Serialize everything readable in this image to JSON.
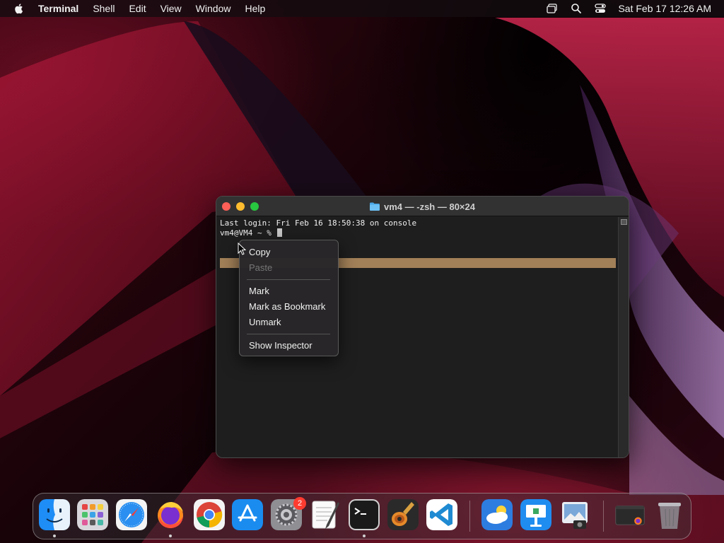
{
  "menubar": {
    "app_name": "Terminal",
    "items": [
      "Shell",
      "Edit",
      "View",
      "Window",
      "Help"
    ],
    "clock": "Sat Feb 17  12:26 AM",
    "status_icons": [
      "display-icon",
      "search-icon",
      "control-center-icon"
    ]
  },
  "window": {
    "title": "vm4 — -zsh — 80×24",
    "terminal_lines": [
      "Last login: Fri Feb 16 18:50:38 on console",
      "vm4@VM4 ~ % "
    ]
  },
  "context_menu": {
    "items": [
      {
        "label": "Copy",
        "enabled": true
      },
      {
        "label": "Paste",
        "enabled": false
      },
      {
        "label": "Mark",
        "enabled": true
      },
      {
        "label": "Mark as Bookmark",
        "enabled": true
      },
      {
        "label": "Unmark",
        "enabled": true
      },
      {
        "label": "Show Inspector",
        "enabled": true
      }
    ]
  },
  "dock": {
    "apps": [
      {
        "icon": "finder-icon",
        "running": true
      },
      {
        "icon": "launchpad-icon",
        "running": false
      },
      {
        "icon": "safari-icon",
        "running": false
      },
      {
        "icon": "firefox-icon",
        "running": true
      },
      {
        "icon": "chrome-icon",
        "running": false
      },
      {
        "icon": "app-store-icon",
        "running": false
      },
      {
        "icon": "system-settings-icon",
        "running": false,
        "badge": "2"
      },
      {
        "icon": "textedit-icon",
        "running": false
      },
      {
        "icon": "terminal-icon",
        "running": true
      },
      {
        "icon": "garageband-icon",
        "running": false
      },
      {
        "icon": "vscode-icon",
        "running": false
      },
      {
        "icon": "weather-icon",
        "running": false
      },
      {
        "icon": "keynote-icon",
        "running": false
      },
      {
        "icon": "preview-icon",
        "running": false
      },
      {
        "icon": "minimized-window-icon",
        "running": false
      },
      {
        "icon": "trash-icon",
        "running": false
      }
    ]
  },
  "colors": {
    "terminal_bg": "#1e1e1e",
    "selection": "#a28058",
    "close": "#fe5f57",
    "minimize": "#febc2e",
    "zoom": "#28c840"
  }
}
